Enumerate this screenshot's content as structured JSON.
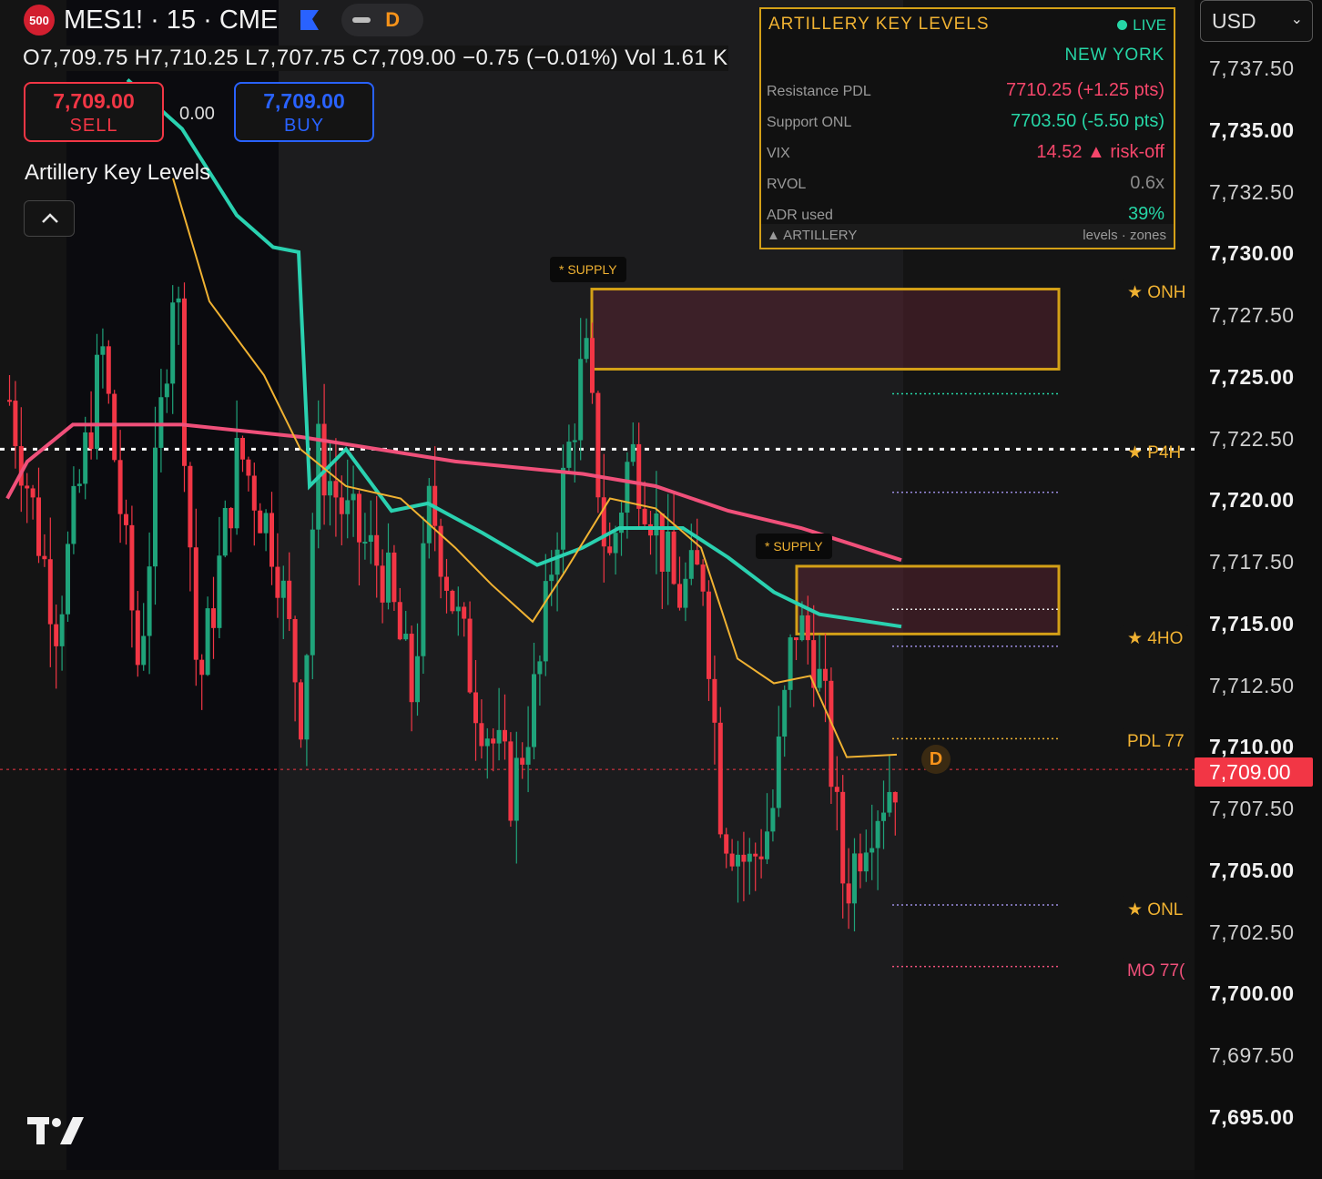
{
  "header": {
    "badge": "500",
    "symbol_line": "MES1! · 15 · CME",
    "flag_icon": "flag-icon",
    "mode_letter": "D"
  },
  "ohlc": {
    "text": "O7,709.75  H7,710.25  L7,707.75  C7,709.00  −0.75 (−0.01%)  Vol 1.61 K"
  },
  "trade": {
    "sell_price": "7,709.00",
    "sell_label": "SELL",
    "spread": "0.00",
    "buy_price": "7,709.00",
    "buy_label": "BUY"
  },
  "indicator": {
    "name": "Artillery Key Levels",
    "collapse_icon": "chevron-up-icon"
  },
  "panel": {
    "title": "ARTILLERY KEY LEVELS",
    "live": "LIVE",
    "session": "NEW YORK",
    "rows": [
      {
        "key": "Resistance PDL",
        "value": "7710.25  (+1.25 pts)",
        "color": "#f6466b"
      },
      {
        "key": "Support ONL",
        "value": "7703.50  (-5.50 pts)",
        "color": "#26d6a6"
      },
      {
        "key": "VIX",
        "value": "14.52  ▲ risk-off",
        "color": "#f6466b"
      },
      {
        "key": "RVOL",
        "value": "0.6x",
        "color": "#8a8a8a"
      },
      {
        "key": "ADR used",
        "value": "39%",
        "color": "#26d6a6"
      }
    ],
    "footer_left": "▲ ARTILLERY",
    "footer_right": "levels · zones"
  },
  "levels": {
    "onh": "★ ONH",
    "p4h": "★ P4H",
    "ho4": "★ 4HO",
    "pdl": "PDL  77",
    "onl": "★ ONL",
    "mo": "MO  77("
  },
  "supply_labels": [
    "* SUPPLY",
    "* SUPPLY"
  ],
  "d_marker": "D",
  "axis": {
    "currency": "USD",
    "ticks": [
      {
        "label": "7,737.50",
        "bold": false
      },
      {
        "label": "7,735.00",
        "bold": true
      },
      {
        "label": "7,732.50",
        "bold": false
      },
      {
        "label": "7,730.00",
        "bold": true
      },
      {
        "label": "7,727.50",
        "bold": false
      },
      {
        "label": "7,725.00",
        "bold": true
      },
      {
        "label": "7,722.50",
        "bold": false
      },
      {
        "label": "7,720.00",
        "bold": true
      },
      {
        "label": "7,717.50",
        "bold": false
      },
      {
        "label": "7,715.00",
        "bold": true
      },
      {
        "label": "7,712.50",
        "bold": false
      },
      {
        "label": "7,710.00",
        "bold": true
      },
      {
        "label": "7,707.50",
        "bold": false
      },
      {
        "label": "7,705.00",
        "bold": true
      },
      {
        "label": "7,702.50",
        "bold": false
      },
      {
        "label": "7,700.00",
        "bold": true
      },
      {
        "label": "7,697.50",
        "bold": false
      },
      {
        "label": "7,695.00",
        "bold": true
      }
    ],
    "last_price": "7,709.00"
  },
  "colors": {
    "bull": "#1fa37a",
    "bear": "#f23645",
    "ema_fast": "#f0b232",
    "ema_mid": "#2ad1b0",
    "ema_slow": "#f0507a",
    "zone_border": "#d4a017"
  },
  "chart_data": {
    "type": "candlestick",
    "timeframe": "15",
    "ylim": [
      7692.5,
      7740
    ],
    "last_price": 7709.0,
    "horizontal_levels": [
      {
        "name": "P4H",
        "price": 7722.0
      },
      {
        "name": "PDL",
        "price": 7710.25
      },
      {
        "name": "ONL",
        "price": 7703.5
      }
    ],
    "supply_zones": [
      {
        "top": 7728.5,
        "bottom": 7725.25
      },
      {
        "top": 7717.25,
        "bottom": 7714.5
      }
    ]
  }
}
